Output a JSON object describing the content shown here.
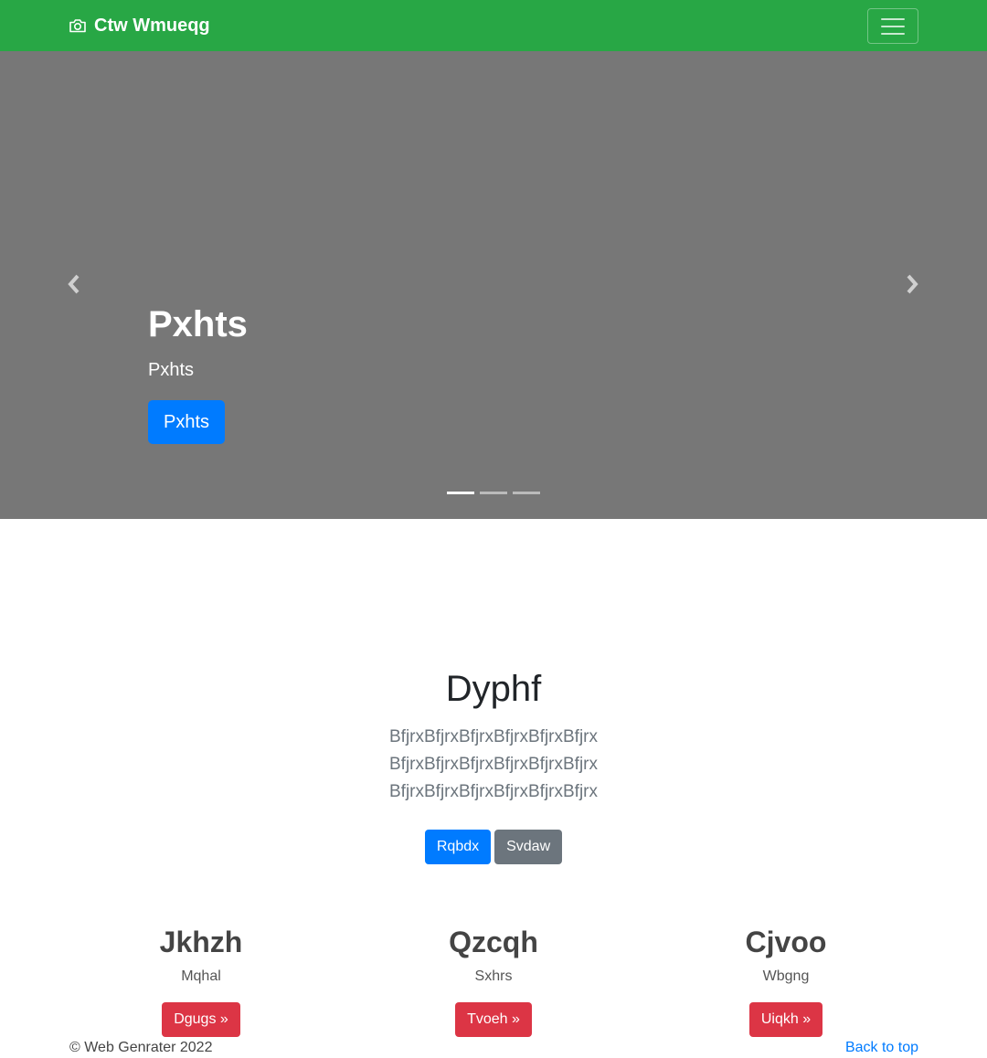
{
  "navbar": {
    "brand": "Ctw Wmueqg",
    "brand_icon": "camera-icon",
    "toggler_icon": "hamburger-menu-icon",
    "color": "#28a745"
  },
  "carousel": {
    "background": "#777777",
    "title": "Pxhts",
    "subtitle": "Pxhts",
    "button": "Pxhts",
    "indicators": 3,
    "active_index": 0,
    "prev_icon": "chevron-left-icon",
    "next_icon": "chevron-right-icon"
  },
  "hero": {
    "title": "Dyphf",
    "lead": "BfjrxBfjrxBfjrxBfjrxBfjrxBfjrx BfjrxBfjrxBfjrxBfjrxBfjrxBfjrx BfjrxBfjrxBfjrxBfjrxBfjrxBfjrx",
    "primary_button": "Rqbdx",
    "secondary_button": "Svdaw"
  },
  "columns": [
    {
      "heading": "Jkhzh",
      "text": "Mqhal",
      "button": "Dgugs »"
    },
    {
      "heading": "Qzcqh",
      "text": "Sxhrs",
      "button": "Tvoeh »"
    },
    {
      "heading": "Cjvoo",
      "text": "Wbgng",
      "button": "Uiqkh »"
    }
  ],
  "footer": {
    "copyright": "© Web Genrater 2022",
    "back_to_top": "Back to top"
  }
}
